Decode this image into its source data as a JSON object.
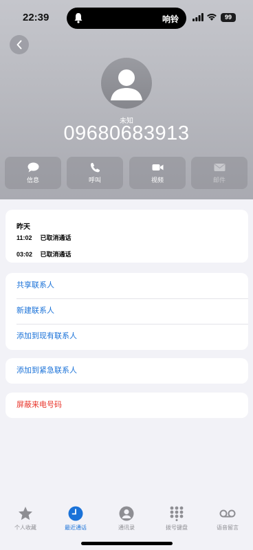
{
  "status_bar": {
    "time": "22:39",
    "ringer_label": "响铃",
    "battery": "99"
  },
  "contact": {
    "name": "未知",
    "number": "09680683913"
  },
  "actions": [
    {
      "label": "信息",
      "icon": "message-icon",
      "enabled": true
    },
    {
      "label": "呼叫",
      "icon": "phone-icon",
      "enabled": true
    },
    {
      "label": "视频",
      "icon": "video-icon",
      "enabled": true
    },
    {
      "label": "邮件",
      "icon": "mail-icon",
      "enabled": false
    }
  ],
  "recents": {
    "day": "昨天",
    "calls": [
      {
        "time": "11:02",
        "status": "已取消通话"
      },
      {
        "time": "03:02",
        "status": "已取消通话"
      }
    ]
  },
  "options": {
    "share_contact": "共享联系人",
    "new_contact": "新建联系人",
    "add_existing": "添加到现有联系人",
    "add_emergency": "添加到紧急联系人",
    "block_caller": "屏蔽来电号码"
  },
  "tabs": [
    {
      "label": "个人收藏",
      "icon": "star-icon",
      "active": false
    },
    {
      "label": "最近通话",
      "icon": "clock-icon",
      "active": true
    },
    {
      "label": "通讯录",
      "icon": "person-circle-icon",
      "active": false
    },
    {
      "label": "拨号键盘",
      "icon": "keypad-icon",
      "active": false
    },
    {
      "label": "语音留言",
      "icon": "voicemail-icon",
      "active": false
    }
  ],
  "colors": {
    "accent": "#1a72d8",
    "destructive": "#e8352b",
    "header_bg": "#b9bac0"
  }
}
